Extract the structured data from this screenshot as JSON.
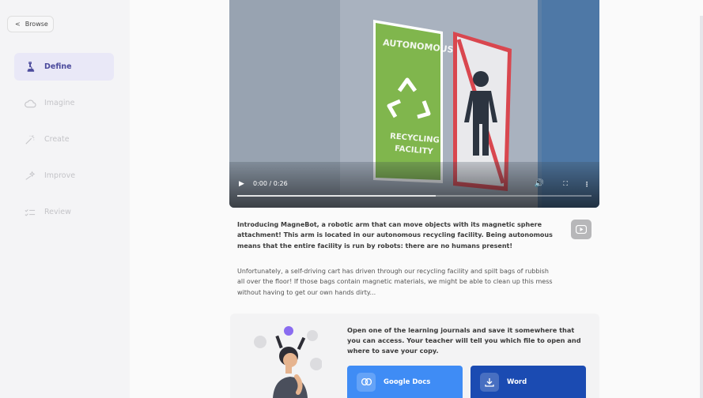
{
  "sidebar": {
    "browse_label": "Browse",
    "items": [
      {
        "label": "Define",
        "icon": "microscope-icon",
        "active": true
      },
      {
        "label": "Imagine",
        "icon": "cloud-icon",
        "active": false
      },
      {
        "label": "Create",
        "icon": "magic-wand-icon",
        "active": false
      },
      {
        "label": "Improve",
        "icon": "sparkle-wand-icon",
        "active": false
      },
      {
        "label": "Review",
        "icon": "checklist-icon",
        "active": false
      }
    ]
  },
  "video": {
    "time": "0:00 / 0:26",
    "progress": 0.56,
    "sign_left_top": "AUTONOMOUS",
    "sign_left_bottom_1": "RECYCLING",
    "sign_left_bottom_2": "FACILITY"
  },
  "description": {
    "p1": "Introducing MagneBot, a robotic arm that can move objects with its magnetic sphere attachment! This arm is located in our autonomous recycling facility. Being autonomous means that the entire facility is run by robots: there are no humans present!",
    "p2": "Unfortunately, a self-driving cart has driven through our recycling facility and spilt bags of rubbish all over the floor! If those bags contain magnetic materials, we might be able to clean up this mess without having to get our own hands dirty..."
  },
  "journal_card": {
    "text": "Open one of the learning journals and save it somewhere that you can access. Your teacher will tell you which file to open and where to save your copy.",
    "google_docs_label": "Google Docs",
    "word_label": "Word"
  },
  "colors": {
    "active_nav_bg": "#e9e8f7",
    "active_nav_text": "#4b4a9c",
    "google_docs_btn": "#3f8cf5",
    "word_btn": "#1b4bb2",
    "recycling_sign": "#7bb34a",
    "no_humans_sign": "#d9474f"
  }
}
